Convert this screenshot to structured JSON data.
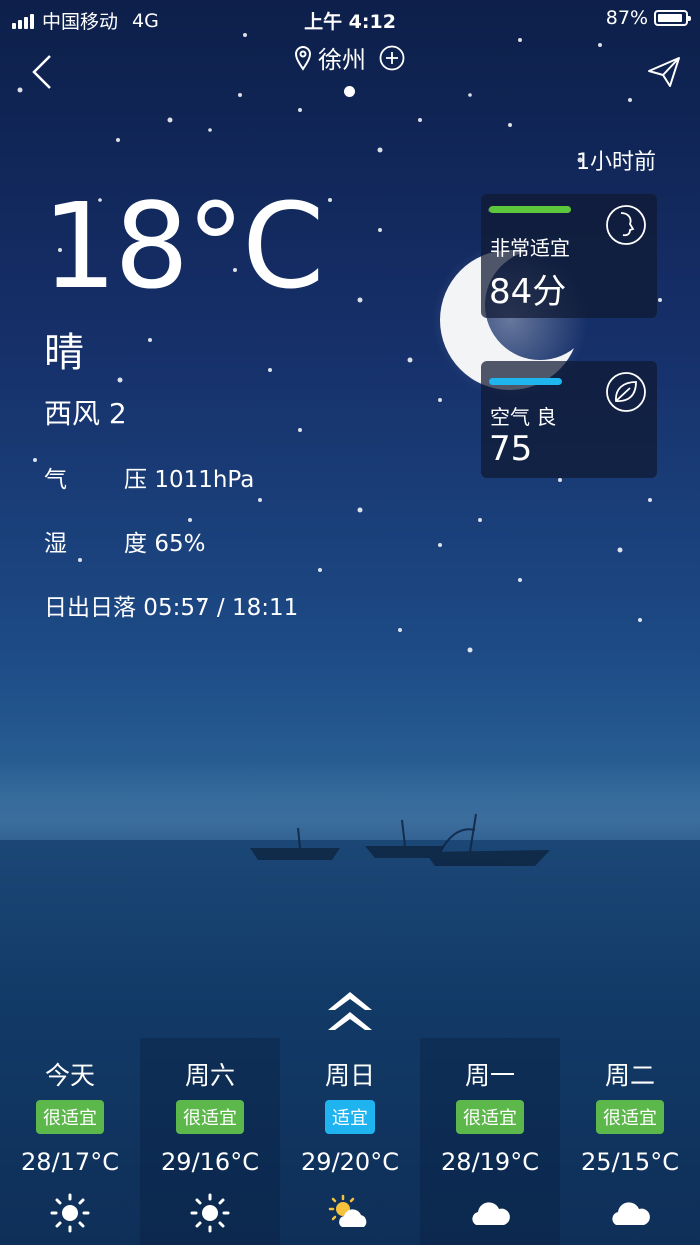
{
  "status_bar": {
    "carrier": "中国移动",
    "network": "4G",
    "time": "上午 4:12",
    "battery": "87%"
  },
  "header": {
    "city": "徐州"
  },
  "updated": "1小时前",
  "current": {
    "temperature": "18°C",
    "condition": "晴",
    "wind": "西风 2",
    "pressure_label": "气",
    "pressure_label2": "压",
    "pressure_value": "1011hPa",
    "humidity_label": "湿",
    "humidity_label2": "度",
    "humidity_value": "65%",
    "sunrise_sunset": "日出日落 05:57 / 18:11"
  },
  "comfort_card": {
    "label": "非常适宜",
    "value": "84分",
    "bar_color": "#5cc73a",
    "icon": "face-profile-icon"
  },
  "air_card": {
    "label": "空气 良",
    "value": "75",
    "bar_color": "#1fb6f0",
    "icon": "leaf-icon"
  },
  "forecast": [
    {
      "day": "今天",
      "badge": "很适宜",
      "badge_color": "#5cb84a",
      "range": "28/17°C",
      "icon": "sun-icon"
    },
    {
      "day": "周六",
      "badge": "很适宜",
      "badge_color": "#5cb84a",
      "range": "29/16°C",
      "icon": "sun-icon"
    },
    {
      "day": "周日",
      "badge": "适宜",
      "badge_color": "#1fb3ef",
      "range": "29/20°C",
      "icon": "partly-cloudy-icon"
    },
    {
      "day": "周一",
      "badge": "很适宜",
      "badge_color": "#5cb84a",
      "range": "28/19°C",
      "icon": "cloud-icon"
    },
    {
      "day": "周二",
      "badge": "很适宜",
      "badge_color": "#5cb84a",
      "range": "25/15°C",
      "icon": "cloud-icon"
    }
  ]
}
